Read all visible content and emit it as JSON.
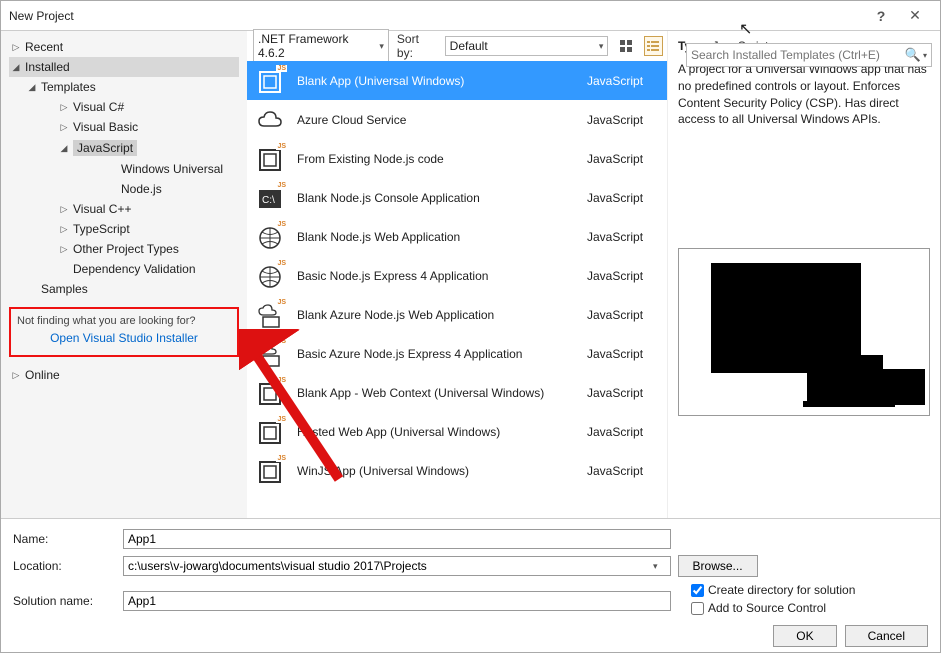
{
  "window": {
    "title": "New Project",
    "help": "?",
    "close": "✕"
  },
  "search": {
    "placeholder": "Search Installed Templates (Ctrl+E)"
  },
  "toolbar": {
    "framework": ".NET Framework 4.6.2",
    "sortby_label": "Sort by:",
    "sortby_value": "Default"
  },
  "left": {
    "recent": "Recent",
    "installed": "Installed",
    "templates": "Templates",
    "langs": [
      "Visual C#",
      "Visual Basic",
      "JavaScript",
      "Visual C++",
      "TypeScript",
      "Other Project Types",
      "Dependency Validation"
    ],
    "js_children": [
      "Windows Universal",
      "Node.js"
    ],
    "samples": "Samples",
    "online": "Online",
    "notfinding": "Not finding what you are looking for?",
    "installer_link": "Open Visual Studio Installer"
  },
  "templates": [
    {
      "name": "Blank App (Universal Windows)",
      "lang": "JavaScript",
      "icon": "box"
    },
    {
      "name": "Azure Cloud Service",
      "lang": "JavaScript",
      "icon": "cloud"
    },
    {
      "name": "From Existing Node.js code",
      "lang": "JavaScript",
      "icon": "box"
    },
    {
      "name": "Blank Node.js Console Application",
      "lang": "JavaScript",
      "icon": "console"
    },
    {
      "name": "Blank Node.js Web Application",
      "lang": "JavaScript",
      "icon": "globe"
    },
    {
      "name": "Basic Node.js Express 4 Application",
      "lang": "JavaScript",
      "icon": "globe"
    },
    {
      "name": "Blank Azure Node.js Web Application",
      "lang": "JavaScript",
      "icon": "cloudbox"
    },
    {
      "name": "Basic Azure Node.js Express 4 Application",
      "lang": "JavaScript",
      "icon": "cloudbox"
    },
    {
      "name": "Blank App - Web Context (Universal Windows)",
      "lang": "JavaScript",
      "icon": "box"
    },
    {
      "name": "Hosted Web App (Universal Windows)",
      "lang": "JavaScript",
      "icon": "box"
    },
    {
      "name": "WinJS App (Universal Windows)",
      "lang": "JavaScript",
      "icon": "box"
    }
  ],
  "details": {
    "type_label": "Type:",
    "type_value": "JavaScript",
    "desc": "A project for a Universal Windows app that has no predefined controls or layout. Enforces Content Security Policy (CSP). Has direct access to all Universal Windows APIs."
  },
  "form": {
    "name_label": "Name:",
    "name_value": "App1",
    "location_label": "Location:",
    "location_value": "c:\\users\\v-jowarg\\documents\\visual studio 2017\\Projects",
    "solution_label": "Solution name:",
    "solution_value": "App1",
    "browse": "Browse...",
    "create_dir": "Create directory for solution",
    "add_source": "Add to Source Control",
    "ok": "OK",
    "cancel": "Cancel"
  }
}
